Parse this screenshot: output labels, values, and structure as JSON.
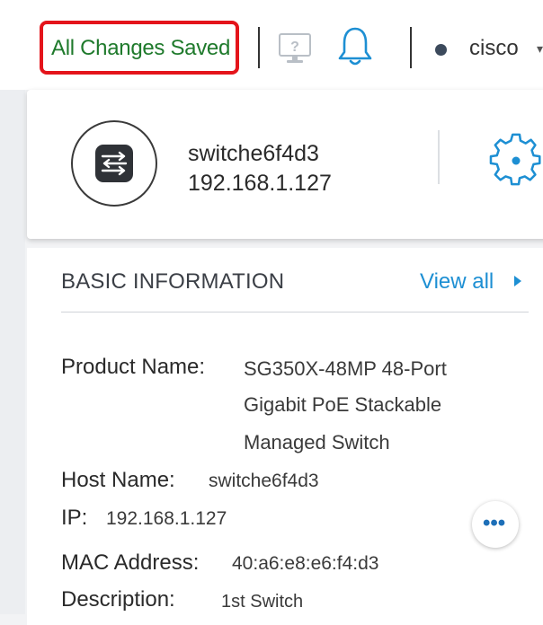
{
  "topbar": {
    "save_status": "All Changes Saved",
    "help_icon": "monitor-question-icon",
    "notifications_icon": "bell-icon",
    "user_name": "cisco",
    "user_menu_caret": "▾",
    "colors": {
      "save_status_text": "#1f7a2c",
      "highlight_box": "#e4141b",
      "user_dot": "#3c4a5c"
    }
  },
  "device": {
    "icon": "switch-icon",
    "hostname": "switche6f4d3",
    "ip": "192.168.1.127",
    "settings_icon": "gear-icon"
  },
  "basic_info": {
    "title": "BASIC INFORMATION",
    "view_all_label": "View all",
    "view_all_color": "#1d8fd3",
    "fields": {
      "product_name_label": "Product Name:",
      "product_name_lines": [
        "SG350X-48MP 48-Port",
        "Gigabit PoE Stackable",
        "Managed Switch"
      ],
      "host_name_label": "Host Name:",
      "host_name_value": "switche6f4d3",
      "ip_label": "IP:",
      "ip_value": "192.168.1.127",
      "mac_label": "MAC Address:",
      "mac_value": "40:a6:e8:e6:f4:d3",
      "description_label": "Description:",
      "description_value": "1st Switch"
    },
    "more_button_label": "•••"
  }
}
